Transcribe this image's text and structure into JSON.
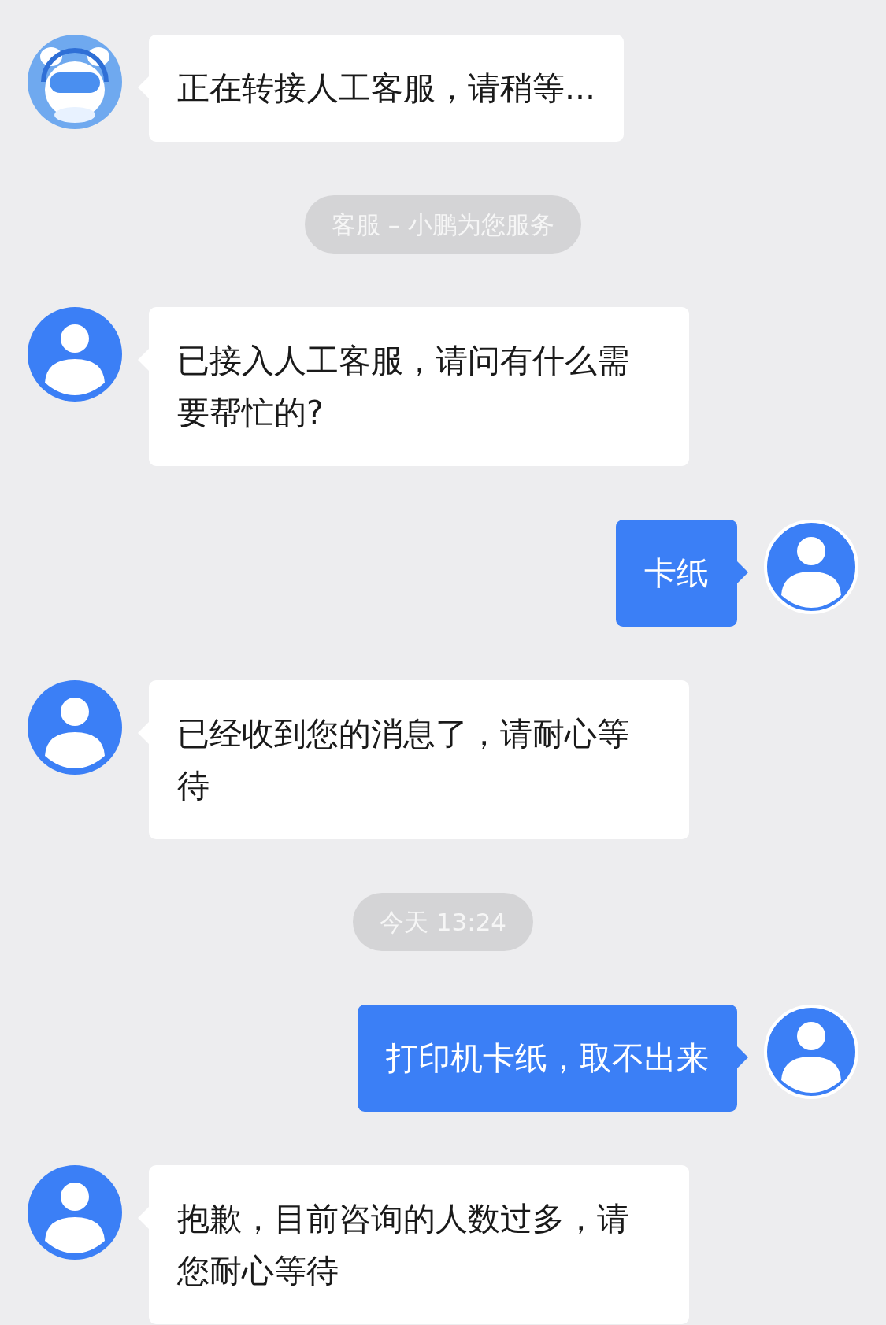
{
  "messages": [
    {
      "kind": "incoming",
      "avatar": {
        "kind": "mascot"
      },
      "text": "正在转接人工客服，请稍等..."
    },
    {
      "kind": "notice",
      "text": "客服 – 小鹏为您服务"
    },
    {
      "kind": "incoming",
      "avatar": {
        "kind": "person"
      },
      "text": "已接入人工客服，请问有什么需要帮忙的?"
    },
    {
      "kind": "outgoing",
      "avatar": {
        "kind": "person"
      },
      "text": "卡纸"
    },
    {
      "kind": "incoming",
      "avatar": {
        "kind": "person"
      },
      "text": "已经收到您的消息了，请耐心等待"
    },
    {
      "kind": "notice",
      "text": "今天 13:24"
    },
    {
      "kind": "outgoing",
      "avatar": {
        "kind": "person"
      },
      "text": "打印机卡纸，取不出来"
    },
    {
      "kind": "incoming",
      "avatar": {
        "kind": "person"
      },
      "text": "抱歉，目前咨询的人数过多，请您耐心等待"
    }
  ]
}
